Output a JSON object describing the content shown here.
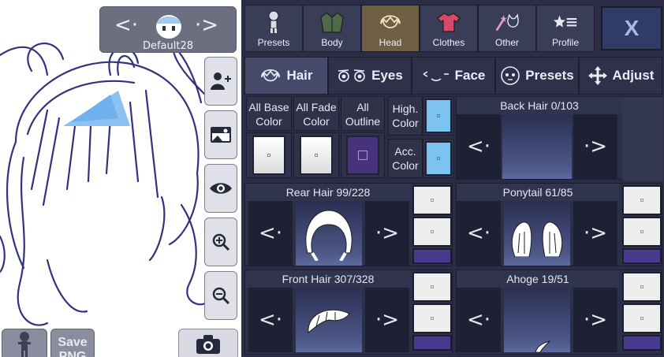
{
  "preview": {
    "character_name": "Default28",
    "left_arrow": "<·",
    "right_arrow": "·>",
    "tools": [
      "add-person-icon",
      "background-icon",
      "eye-icon",
      "zoom-in-icon",
      "zoom-out-icon"
    ],
    "save_label": "Save PNG",
    "camera_icon": "camera-icon"
  },
  "categories": [
    {
      "label": "Presets",
      "icon": "preset-doll-icon"
    },
    {
      "label": "Body",
      "icon": "jacket-icon"
    },
    {
      "label": "Head",
      "icon": "hair-icon",
      "active": true
    },
    {
      "label": "Clothes",
      "icon": "shirt-icon"
    },
    {
      "label": "Other",
      "icon": "cat-wand-icon"
    },
    {
      "label": "Profile",
      "icon": "star-list-icon"
    }
  ],
  "close_label": "X",
  "subtabs": [
    {
      "label": "Hair",
      "icon": "hair-icon",
      "active": true
    },
    {
      "label": "Eyes",
      "icon": "eyes-icon"
    },
    {
      "label": "Face",
      "icon": "face-icon"
    },
    {
      "label": "Presets",
      "icon": "face-preset-icon"
    },
    {
      "label": "Adjust",
      "icon": "move-arrows-icon"
    }
  ],
  "color_controls": {
    "all_base_color": "All Base Color",
    "all_fade_color": "All Fade Color",
    "all_outline": "All Outline",
    "high_color": "High. Color",
    "acc_color": "Acc. Color"
  },
  "parts": {
    "back_hair": {
      "title": "Back Hair 0/103"
    },
    "rear_hair": {
      "title": "Rear Hair 99/228"
    },
    "ponytail": {
      "title": "Ponytail 61/85"
    },
    "front_hair": {
      "title": "Front Hair 307/328"
    },
    "ahoge": {
      "title": "Ahoge 19/51"
    }
  },
  "nav": {
    "prev": "<·",
    "next": "·>"
  },
  "colors": {
    "panel": "#2a2d44",
    "active_tab": "#6e5f45",
    "outline": "#47337c",
    "highlight": "#7cc3f1",
    "close": "#2f3c66"
  }
}
